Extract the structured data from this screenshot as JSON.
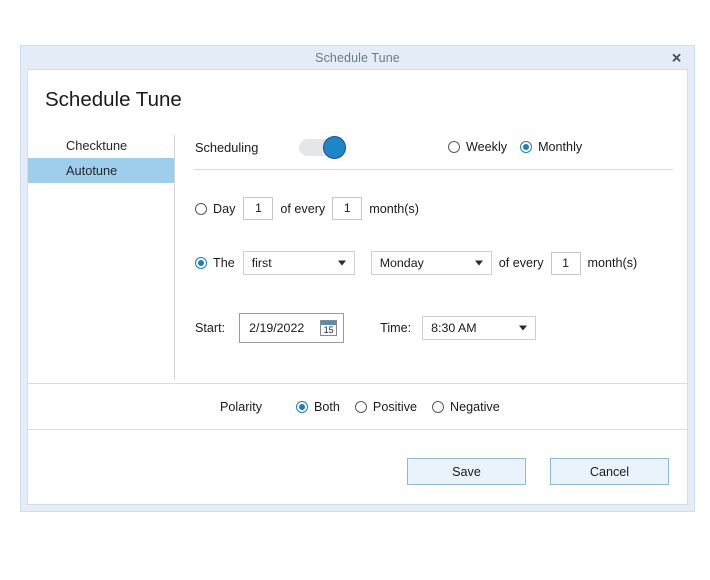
{
  "window": {
    "title": "Schedule Tune",
    "close_icon": "close-icon",
    "close_glyph": "✕"
  },
  "heading": "Schedule Tune",
  "sidebar": {
    "items": [
      {
        "label": "Checktune",
        "selected": false
      },
      {
        "label": "Autotune",
        "selected": true
      }
    ]
  },
  "scheduling": {
    "label": "Scheduling",
    "toggle_on": true,
    "frequency": {
      "options": [
        {
          "label": "Weekly",
          "selected": false
        },
        {
          "label": "Monthly",
          "selected": true
        }
      ]
    }
  },
  "day_rule": {
    "selected": false,
    "label": "Day",
    "day_value": "1",
    "of_every": "of every",
    "interval_value": "1",
    "months_unit": "month(s)"
  },
  "the_rule": {
    "selected": true,
    "label": "The",
    "ordinal": "first",
    "weekday": "Monday",
    "of_every": "of every",
    "interval_value": "1",
    "months_unit": "month(s)",
    "caret_icon": "chevron-down-icon"
  },
  "start": {
    "label": "Start:",
    "date_value": "2/19/2022",
    "calendar_icon": "calendar-icon",
    "calendar_day": "15",
    "time_label": "Time:",
    "time_value": "8:30 AM"
  },
  "polarity": {
    "label": "Polarity",
    "options": [
      {
        "label": "Both",
        "selected": true
      },
      {
        "label": "Positive",
        "selected": false
      },
      {
        "label": "Negative",
        "selected": false
      }
    ]
  },
  "footer": {
    "save_label": "Save",
    "cancel_label": "Cancel"
  },
  "colors": {
    "accent": "#1b7ec0",
    "titlebar": "#e4edf7",
    "selection": "#9fcdec",
    "button_border": "#8fb8d9",
    "button_fill": "#eaf3fb"
  }
}
